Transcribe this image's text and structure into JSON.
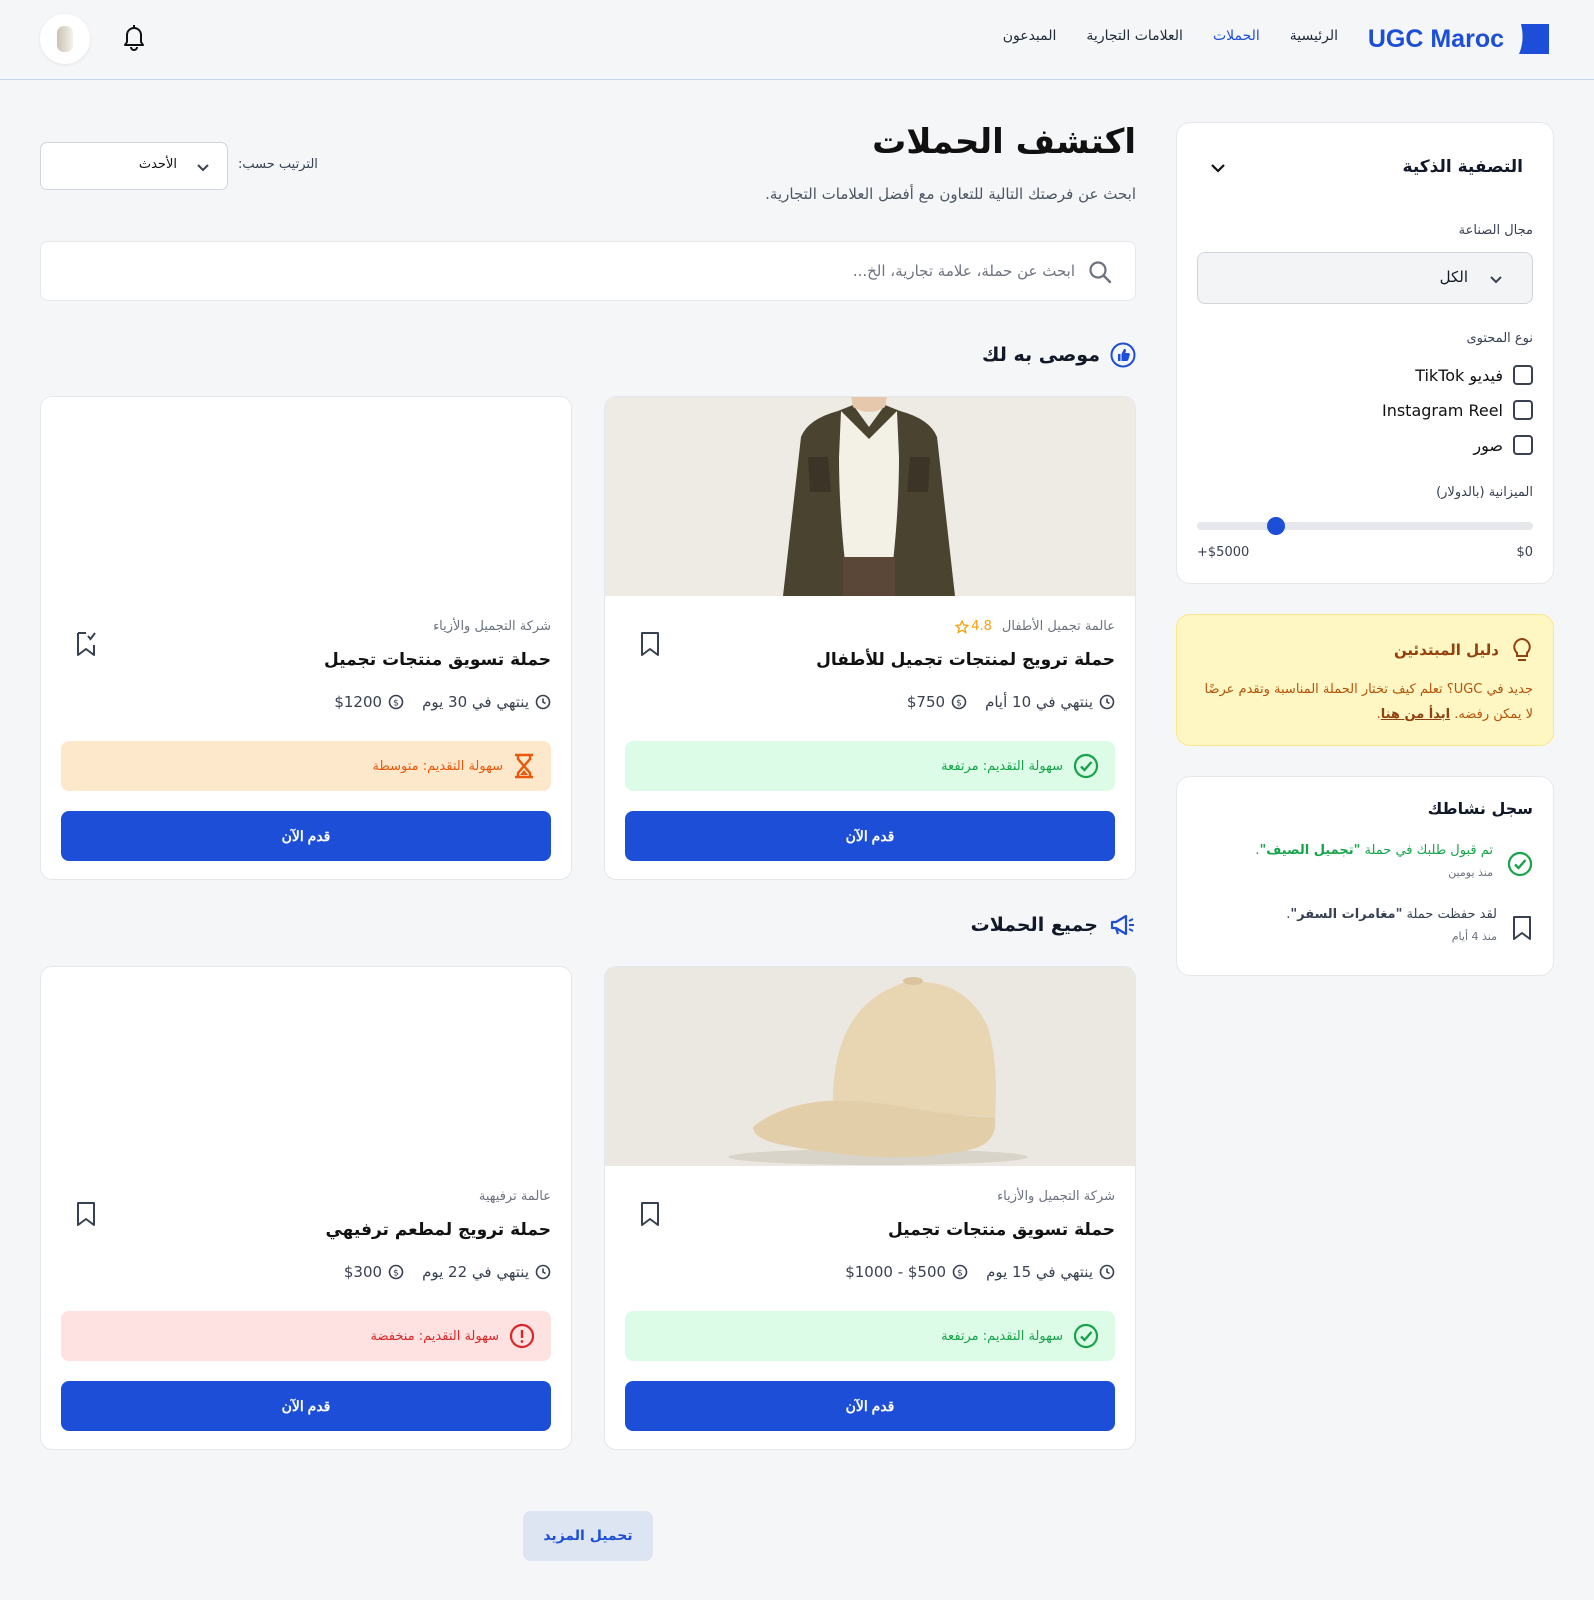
{
  "header": {
    "logo_text": "UGC Maroc",
    "nav": [
      {
        "label": "الرئيسية",
        "active": false
      },
      {
        "label": "الحملات",
        "active": true
      },
      {
        "label": "العلامات التجارية",
        "active": false
      },
      {
        "label": "المبدعون",
        "active": false
      }
    ],
    "icons": [
      "bell-icon",
      "avatar"
    ]
  },
  "main": {
    "title": "اكتشف الحملات",
    "subtitle": "ابحث عن فرصتك التالية للتعاون مع أفضل العلامات التجارية.",
    "sort": {
      "label": "الترتيب حسب:",
      "value": "الأحدث"
    },
    "search": {
      "placeholder": "ابحث عن حملة، علامة تجارية، الخ..."
    },
    "recommended_title": "موصى به لك",
    "all_title": "جميع الحملات",
    "load_more": "تحميل المزيد"
  },
  "campaigns": [
    {
      "brand": "عالمة تجميل الأطفال",
      "rating": "4.8",
      "title": "حملة ترويج لمنتجات تجميل للأطفال",
      "ends": "ينتهي في 10 أيام",
      "budget": "$750",
      "ease": "سهولة التقديم: مرتفعة",
      "ease_level": "high",
      "apply": "قدم الآن",
      "image": "jacket-photo"
    },
    {
      "brand": "شركة التجميل والأزياء",
      "title": "حملة تسويق منتجات تجميل",
      "ends": "ينتهي في 30 يوم",
      "budget": "$1200",
      "ease": "سهولة التقديم: متوسطة",
      "ease_level": "mid",
      "apply": "قدم الآن",
      "image": "blank"
    },
    {
      "brand": "شركة التجميل والأزياء",
      "title": "حملة تسويق منتجات تجميل",
      "ends": "ينتهي في 15 يوم",
      "budget": "$500 - $1000",
      "ease": "سهولة التقديم: مرتفعة",
      "ease_level": "high",
      "apply": "قدم الآن",
      "image": "cap-photo"
    },
    {
      "brand": "عالمة ترفيهية",
      "title": "حملة ترويج لمطعم ترفيهي",
      "ends": "ينتهي في 22 يوم",
      "budget": "$300",
      "ease": "سهولة التقديم: منخفضة",
      "ease_level": "low",
      "apply": "قدم الآن",
      "image": "blank"
    }
  ],
  "filter": {
    "title": "التصفية الذكية",
    "industry_label": "مجال الصناعة",
    "industry_value": "الكل",
    "content_label": "نوع المحتوى",
    "options": [
      "فيديو TikTok",
      "Instagram Reel",
      "صور"
    ],
    "budget_label": "الميزانية (بالدولار)",
    "budget_min": "$0",
    "budget_max": "$5000+",
    "slider_value_fraction": 0.78
  },
  "guide": {
    "title": "دليل المبتدئين",
    "text": "جديد في UGC؟ تعلم كيف تختار الحملة المناسبة وتقدم عرضًا لا يمكن رفضه.",
    "link": "ابدأ من هنا"
  },
  "activity": {
    "title": "سجل نشاطك",
    "items": [
      {
        "text_prefix": "تم قبول طلبك في حملة ",
        "highlight": "\"تجميل الصيف\"",
        "suffix": ".",
        "time": "منذ يومين",
        "icon": "check-circle-icon"
      },
      {
        "text_prefix": "لقد حفظت حملة ",
        "highlight": "\"مغامرات السفر\"",
        "suffix": ".",
        "time": "منذ 4 أيام",
        "icon": "bookmark-icon"
      }
    ]
  },
  "colors": {
    "primary": "#1d4ed8",
    "success": "#16a34a",
    "warning": "#ea580c",
    "danger": "#dc2626",
    "guide_bg": "#fef7c3"
  }
}
